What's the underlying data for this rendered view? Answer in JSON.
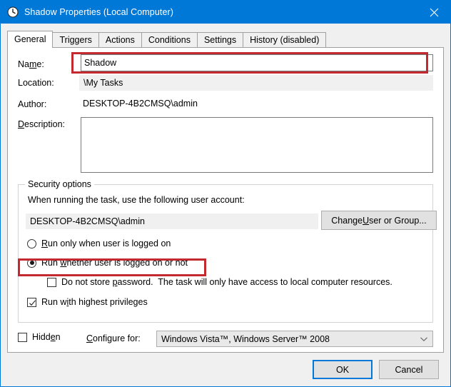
{
  "window": {
    "title": "Shadow Properties (Local Computer)",
    "icon": "task-scheduler-clock-icon",
    "close_label": "✕",
    "accent_color": "#0078d7",
    "annotation_color": "#c22a2f"
  },
  "tabs": [
    {
      "label": "General",
      "active": true
    },
    {
      "label": "Triggers",
      "active": false
    },
    {
      "label": "Actions",
      "active": false
    },
    {
      "label": "Conditions",
      "active": false
    },
    {
      "label": "Settings",
      "active": false
    },
    {
      "label": "History (disabled)",
      "active": false
    }
  ],
  "general": {
    "name_label": "Name:",
    "name_value": "Shadow",
    "location_label": "Location:",
    "location_value": "\\My Tasks",
    "author_label": "Author:",
    "author_value": "DESKTOP-4B2CMSQ\\admin",
    "description_label": "Description:",
    "description_value": ""
  },
  "security_options": {
    "group_label": "Security options",
    "account_prompt": "When running the task, use the following user account:",
    "account_value": "DESKTOP-4B2CMSQ\\admin",
    "change_user_button": "Change User or Group...",
    "radio_logged_on": "Run only when user is logged on",
    "radio_logged_on_checked": false,
    "radio_whether_logged_on": "Run whether user is logged on or not",
    "radio_whether_logged_on_checked": true,
    "checkbox_no_password": "Do not store password.  The task will only have access to local computer resources.",
    "checkbox_no_password_checked": false,
    "checkbox_highest_privileges": "Run with highest privileges",
    "checkbox_highest_privileges_checked": true
  },
  "footer": {
    "hidden_label": "Hidden",
    "hidden_checked": false,
    "configure_for_label": "Configure for:",
    "configure_for_value": "Windows Vista™, Windows Server™ 2008",
    "ok_button": "OK",
    "cancel_button": "Cancel"
  }
}
